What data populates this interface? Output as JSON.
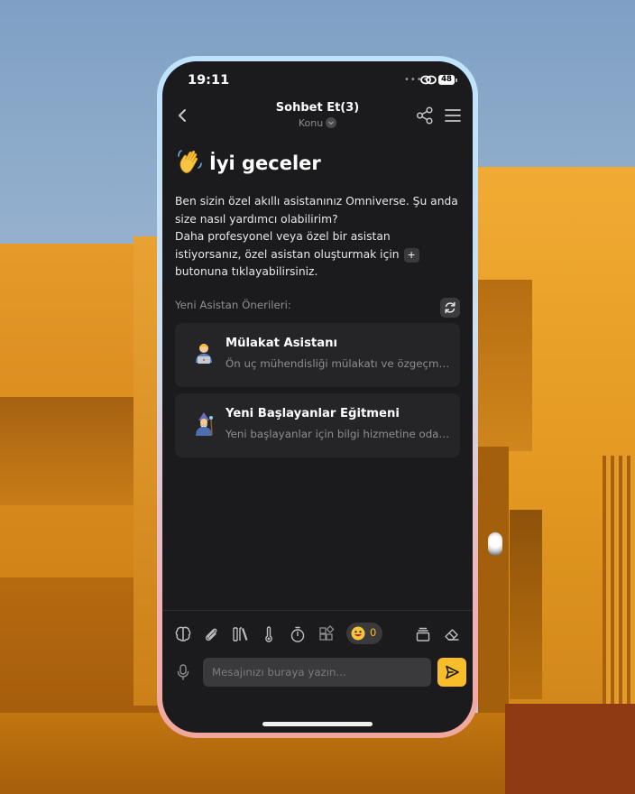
{
  "status_bar": {
    "time": "19:11",
    "signal_dots": "••••",
    "battery": "48"
  },
  "header": {
    "title": "Sohbet Et(3)",
    "subtitle": "Konu"
  },
  "greeting": {
    "text": "İyi geceler",
    "emoji_icon": "waving-hand-icon"
  },
  "intro": {
    "line1": "Ben sizin özel akıllı asistanınız Omniverse. Şu anda size nasıl yardımcı olabilirim?",
    "line2_before": "Daha profesyonel veya özel bir asistan istiyorsanız, özel asistan oluşturmak için",
    "plus_label": "+",
    "line2_after": "butonuna tıklayabilirsiniz."
  },
  "suggestions": {
    "label": "Yeni Asistan Önerileri:",
    "items": [
      {
        "icon": "technologist-emoji-icon",
        "title": "Mülakat Asistanı",
        "desc": "Ön uç mühendisliği mülakatı ve özgeçmiş..."
      },
      {
        "icon": "mage-emoji-icon",
        "title": "Yeni Başlayanlar Eğitmeni",
        "desc": "Yeni başlayanlar için bilgi hizmetine odakl..."
      }
    ]
  },
  "toolbar": {
    "tools": [
      "brain-icon",
      "paperclip-icon",
      "library-icon",
      "thermometer-icon",
      "timer-icon",
      "plugins-icon",
      "emoji-icon",
      "layers-icon",
      "eraser-icon"
    ],
    "emoji_count": "0"
  },
  "composer": {
    "placeholder": "Mesajınızı buraya yazın..."
  },
  "colors": {
    "accent": "#f7bd2a",
    "background": "#1b1b1d",
    "card": "#252527"
  }
}
